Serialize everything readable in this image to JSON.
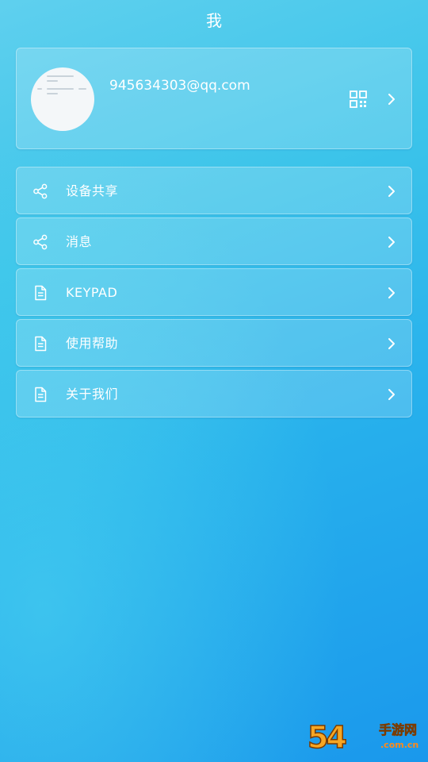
{
  "header": {
    "title": "我"
  },
  "profile": {
    "email": "945634303@qq.com",
    "qr_icon": "qr-code-icon",
    "arrow_icon": "chevron-right-icon"
  },
  "menu": {
    "items": [
      {
        "label": "设备共享",
        "icon": "share-icon"
      },
      {
        "label": "消息",
        "icon": "share-icon"
      },
      {
        "label": "KEYPAD",
        "icon": "document-icon"
      },
      {
        "label": "使用帮助",
        "icon": "document-icon"
      },
      {
        "label": "关于我们",
        "icon": "document-icon"
      }
    ]
  },
  "watermark": {
    "number": "54",
    "text": "手游网",
    "domain": ".com.cn"
  },
  "colors": {
    "background_start": "#5fd0ee",
    "background_end": "#1a98ec",
    "text": "#ffffff",
    "card_fill": "rgba(255,255,255,0.18)"
  }
}
